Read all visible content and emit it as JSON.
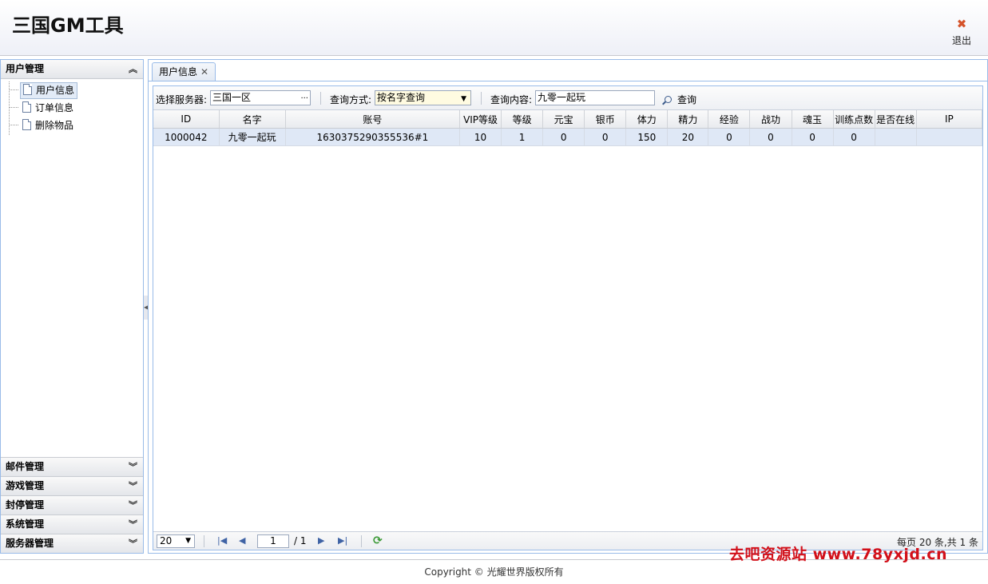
{
  "header": {
    "title": "三国GM工具",
    "exit_label": "退出",
    "exit_icon": "close-icon"
  },
  "sidebar": {
    "sections": [
      {
        "label": "用户管理",
        "expanded": true,
        "items": [
          {
            "label": "用户信息",
            "selected": true
          },
          {
            "label": "订单信息"
          },
          {
            "label": "删除物品"
          }
        ]
      },
      {
        "label": "邮件管理"
      },
      {
        "label": "游戏管理"
      },
      {
        "label": "封停管理"
      },
      {
        "label": "系统管理"
      },
      {
        "label": "服务器管理"
      }
    ]
  },
  "main": {
    "tab": {
      "label": "用户信息"
    },
    "toolbar": {
      "server_label": "选择服务器:",
      "server_value": "三国一区",
      "server_btn": "···",
      "mode_label": "查询方式:",
      "mode_value": "按名字查询",
      "content_label": "查询内容:",
      "content_value": "九零一起玩",
      "search_label": "查询"
    },
    "grid": {
      "columns": [
        "ID",
        "名字",
        "账号",
        "VIP等级",
        "等级",
        "元宝",
        "银币",
        "体力",
        "精力",
        "经验",
        "战功",
        "魂玉",
        "训练点数",
        "是否在线",
        "IP"
      ],
      "rows": [
        [
          "1000042",
          "九零一起玩",
          "1630375290355536#1",
          "10",
          "1",
          "0",
          "0",
          "150",
          "20",
          "0",
          "0",
          "0",
          "0",
          "",
          ""
        ]
      ]
    },
    "pager": {
      "page_size": "20",
      "page": "1",
      "total_pages": "/ 1",
      "info": "每页 20 条,共 1 条"
    }
  },
  "footer": {
    "copyright": "Copyright © 光耀世界版权所有"
  },
  "watermark": "去吧资源站 www.78yxjd.cn",
  "colors": {
    "accent_border": "#99bbe8",
    "selected_row": "#dfe8f6",
    "watermark": "#d2101a"
  }
}
